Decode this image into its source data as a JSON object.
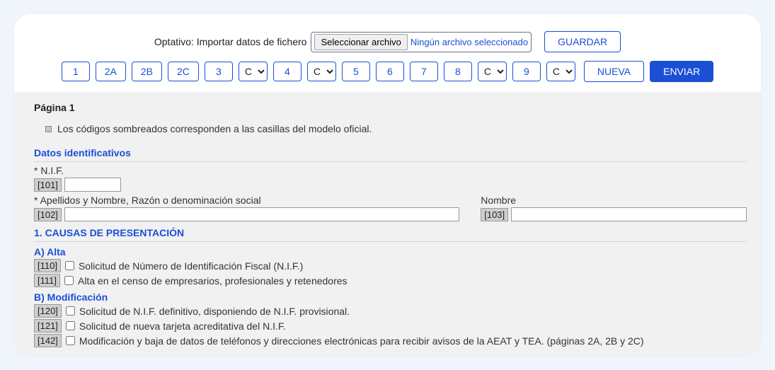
{
  "toolbar": {
    "import_label": "Optativo: Importar datos de fichero",
    "file_button": "Seleccionar archivo",
    "file_status": "Ningún archivo seleccionado",
    "save": "GUARDAR",
    "nueva": "NUEVA",
    "enviar": "ENVIAR"
  },
  "nav": {
    "b1": "1",
    "b2a": "2A",
    "b2b": "2B",
    "b2c": "2C",
    "b3": "3",
    "sel_c": "C",
    "b4": "4",
    "b5": "5",
    "b6": "6",
    "b7": "7",
    "b8": "8",
    "b9": "9"
  },
  "page": {
    "title": "Página 1",
    "hint": "Los códigos sombreados corresponden a las casillas del modelo oficial."
  },
  "datos": {
    "title": "Datos identificativos",
    "nif_label": "* N.I.F.",
    "nif_code": "[101]",
    "apellidos_label": "* Apellidos y Nombre, Razón o denominación social",
    "apellidos_code": "[102]",
    "nombre_label": "Nombre",
    "nombre_code": "[103]"
  },
  "causas": {
    "title": "1. CAUSAS DE PRESENTACIÓN",
    "alta_title": "A) Alta",
    "c110_code": "[110]",
    "c110_label": "Solicitud de Número de Identificación Fiscal (N.I.F.)",
    "c111_code": "[111]",
    "c111_label": "Alta en el censo de empresarios, profesionales y retenedores",
    "mod_title": "B) Modificación",
    "c120_code": "[120]",
    "c120_label": "Solicitud de N.I.F. definitivo, disponiendo de N.I.F. provisional.",
    "c121_code": "[121]",
    "c121_label": "Solicitud de nueva tarjeta acreditativa del N.I.F.",
    "c142_code": "[142]",
    "c142_label": "Modificación y baja de datos de teléfonos y direcciones electrónicas para recibir avisos de la AEAT y TEA. (páginas 2A, 2B y 2C)"
  }
}
